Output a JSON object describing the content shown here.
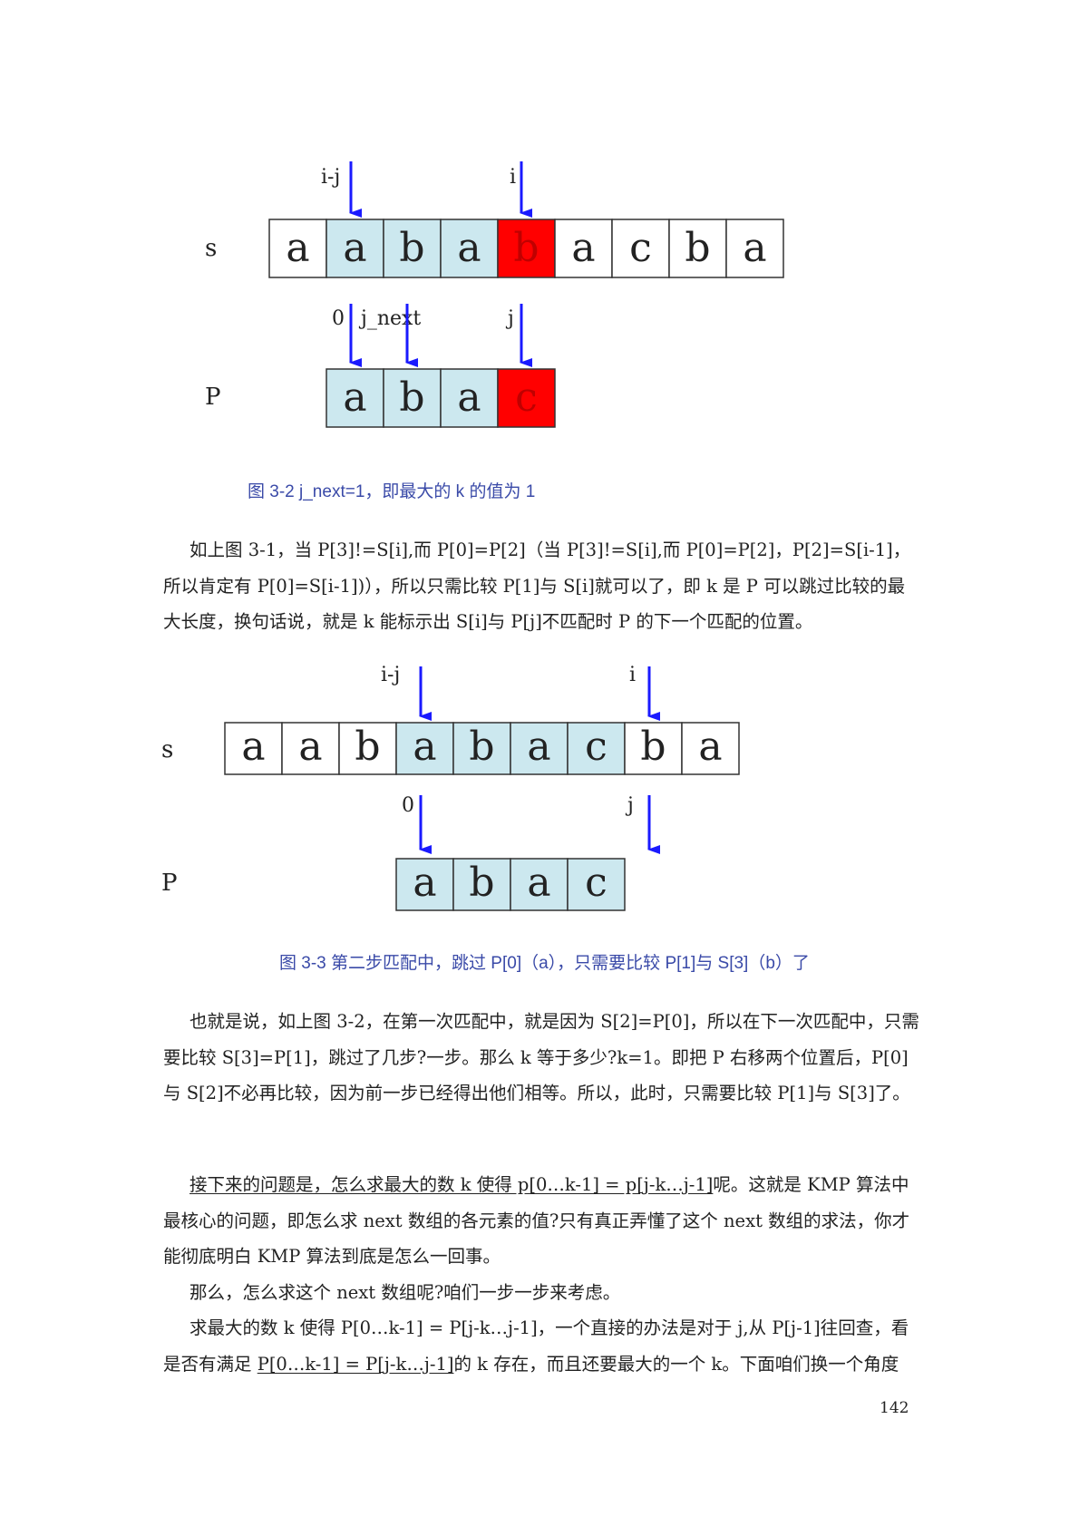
{
  "colors": {
    "cell_blue": "#cce8ef",
    "cell_red": "#ff0000",
    "arrow_blue": "#1a1aff",
    "caption_blue": "#3a4aa8"
  },
  "figure1": {
    "s_label": "s",
    "p_label": "P",
    "s_cells": [
      "a",
      "a",
      "b",
      "a",
      "b",
      "a",
      "c",
      "b",
      "a"
    ],
    "s_fills": [
      "white",
      "blue",
      "blue",
      "blue",
      "red",
      "white",
      "white",
      "white",
      "white"
    ],
    "p_cells": [
      "a",
      "b",
      "a",
      "c"
    ],
    "p_fills": [
      "blue",
      "blue",
      "blue",
      "red"
    ],
    "pointer_i_j": "i-j",
    "pointer_i": "i",
    "pointer_0": "0",
    "pointer_j_next": "j_next",
    "pointer_j": "j",
    "caption": "图 3-2 j_next=1，即最大的 k 的值为 1"
  },
  "para1": "如上图 3-1，当 P[3]!=S[i],而 P[0]=P[2]（当 P[3]!=S[i],而 P[0]=P[2]，P[2]=S[i-1]，所以肯定有 P[0]=S[i-1])），所以只需比较 P[1]与 S[i]就可以了，即 k 是 P 可以跳过比较的最大长度，换句话说，就是 k 能标示出 S[i]与 P[j]不匹配时 P 的下一个匹配的位置。",
  "figure2": {
    "s_label": "s",
    "p_label": "P",
    "s_cells": [
      "a",
      "a",
      "b",
      "a",
      "b",
      "a",
      "c",
      "b",
      "a"
    ],
    "s_fills": [
      "white",
      "white",
      "white",
      "blue",
      "blue",
      "blue",
      "blue",
      "white",
      "white"
    ],
    "p_cells": [
      "a",
      "b",
      "a",
      "c"
    ],
    "p_fills": [
      "blue",
      "blue",
      "blue",
      "blue"
    ],
    "pointer_i_j": "i-j",
    "pointer_i": "i",
    "pointer_0": "0",
    "pointer_j": "j",
    "caption": "图 3-3 第二步匹配中，跳过 P[0]（a），只需要比较 P[1]与 S[3]（b）了"
  },
  "para2": "也就是说，如上图 3-2，在第一次匹配中，就是因为 S[2]=P[0]，所以在下一次匹配中，只需要比较 S[3]=P[1]，跳过了几步?一步。那么 k 等于多少?k=1。即把 P 右移两个位置后，P[0]与 S[2]不必再比较，因为前一步已经得出他们相等。所以，此时，只需要比较 P[1]与 S[3]了。",
  "para3": {
    "underlined": "接下来的问题是，怎么求最大的数 k 使得 p[0…k-1] = p[j-k…j-1]",
    "rest": "呢。这就是 KMP 算法中最核心的问题，即怎么求 next 数组的各元素的值?只有真正弄懂了这个 next 数组的求法，你才能彻底明白 KMP 算法到底是怎么一回事。"
  },
  "para4": "那么，怎么求这个 next 数组呢?咱们一步一步来考虑。",
  "para5": {
    "before": "求最大的数 k 使得 P[0…k-1] = P[j-k…j-1]，一个直接的办法是对于 j,从 P[j-1]往回查，看是否有满足 ",
    "underlined": "P[0…k-1] = P[j-k…j-1]",
    "after": "的 k 存在，而且还要最大的一个 k。下面咱们换一个角度"
  },
  "page_number": "142"
}
